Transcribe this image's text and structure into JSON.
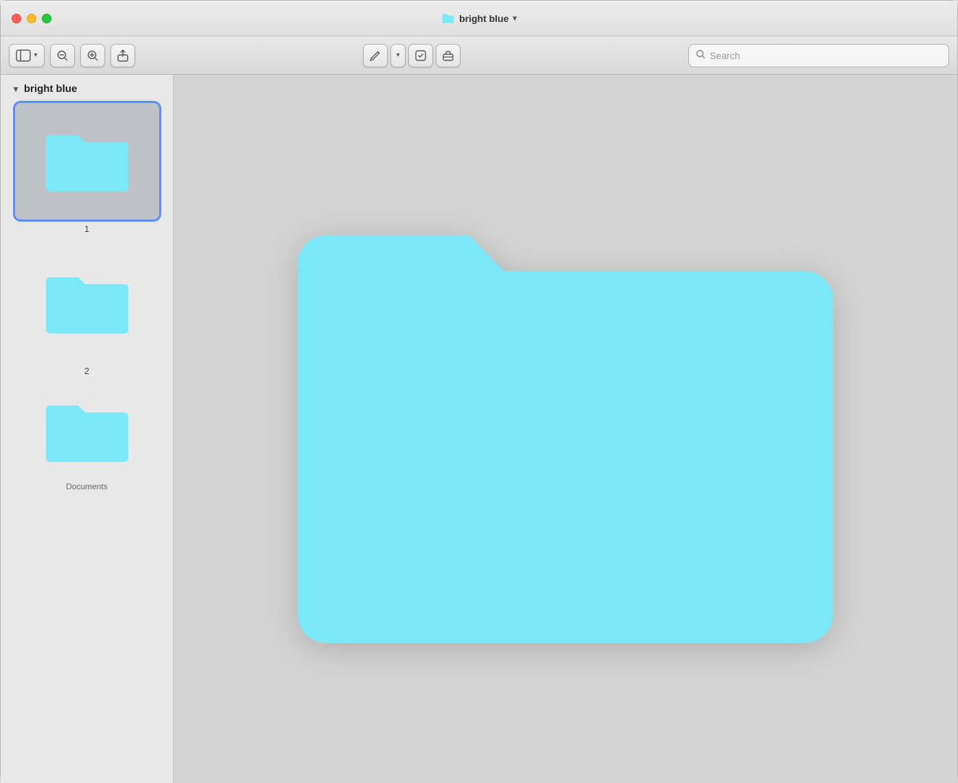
{
  "titlebar": {
    "title": "bright blue",
    "chevron": "▾"
  },
  "toolbar": {
    "sidebar_toggle_label": "⊞",
    "zoom_out_label": "−",
    "zoom_in_label": "+",
    "share_label": "↑",
    "pen_label": "✏",
    "pen_dropdown_label": "▾",
    "action1_label": "⬛",
    "action2_label": "⊞",
    "search_placeholder": "Search"
  },
  "sidebar": {
    "title": "bright blue",
    "chevron": "▼",
    "items": [
      {
        "label": "1",
        "selected": true
      },
      {
        "label": "2",
        "selected": false
      },
      {
        "label": "",
        "selected": false,
        "partial": true
      }
    ],
    "bottom_label": "Documents"
  },
  "folder": {
    "color": "#7ae8f7"
  },
  "icons": {
    "search": "🔍",
    "chevron_down": "▾",
    "sidebar": "▤",
    "zoom_out": "−",
    "zoom_in": "+",
    "share": "↑",
    "pen": "✏",
    "action_share": "⬚",
    "briefcase": "💼"
  }
}
